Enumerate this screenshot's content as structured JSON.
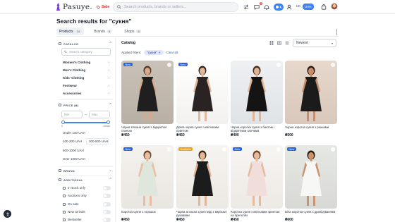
{
  "header": {
    "brand": "Pasuye.",
    "sale_label": "Sale",
    "search_placeholder": "Search products, brands or sellers...",
    "notif_count": "3",
    "lang": "UK",
    "currency": "UAH"
  },
  "page": {
    "title": "Search results for \"сукня\"",
    "tabs": [
      {
        "label": "Products",
        "count": "24"
      },
      {
        "label": "Brands",
        "count": "8"
      },
      {
        "label": "Shops",
        "count": "6"
      }
    ]
  },
  "sidebar": {
    "catalog_title": "CATALOG",
    "search_placeholder": "Search category",
    "categories": [
      "Women's Clothing",
      "Men's Clothing",
      "Kids' Clothing",
      "Footwear",
      "Accessories"
    ],
    "price_title": "PRICE (₴)",
    "min_placeholder": "Min",
    "max_placeholder": "Max",
    "slider_min": "0",
    "slider_max": "10000",
    "slider_low": 0.0,
    "slider_high": 1.0,
    "price_options": [
      "Under 100 UAH",
      "100-300 UAH",
      "300-500 UAH",
      "500-1000 UAH",
      "Over 1000 UAH"
    ],
    "brand_title": "BRAND",
    "additional_title": "ADDITIONAL",
    "additional_options": [
      "In stock only",
      "Auctions only",
      "On sale",
      "New arrivals",
      "Bestseller"
    ]
  },
  "catalog": {
    "label": "Catalog",
    "sort": "Newest",
    "applied_label": "Applied filters:",
    "chip": "\"сукня\"",
    "clear_all": "Clear all",
    "products": [
      {
        "name": "Чорна в'язана сукня з відкритою спиною",
        "price": "₴450",
        "badge": "New"
      },
      {
        "name": "Довга чорна сукня з квітковим принтом",
        "price": "₴450",
        "badge": "New"
      },
      {
        "name": "Чорна коротка сукня з бантом і відкритими плечима",
        "price": "₴400",
        "badge": ""
      },
      {
        "name": "Чорна коротка сукня з рюшами",
        "price": "₴500",
        "badge": ""
      },
      {
        "name": "Коротка сукня з горошок",
        "price": "₴450",
        "badge": "New"
      },
      {
        "name": "Чорна атласна сукня міді з вирізом і рукавами",
        "price": "₴450",
        "badge": "Available"
      },
      {
        "name": "Коротка сукня з квітковим принтом на бретелях",
        "price": "₴450",
        "badge": "New"
      },
      {
        "name": "Біла коротка сукня з драпіруванням",
        "price": "₴600",
        "badge": "New"
      }
    ]
  },
  "colors": {
    "accent": "#2563eb",
    "sale": "#dc2626",
    "logo": "#7c3aed"
  }
}
